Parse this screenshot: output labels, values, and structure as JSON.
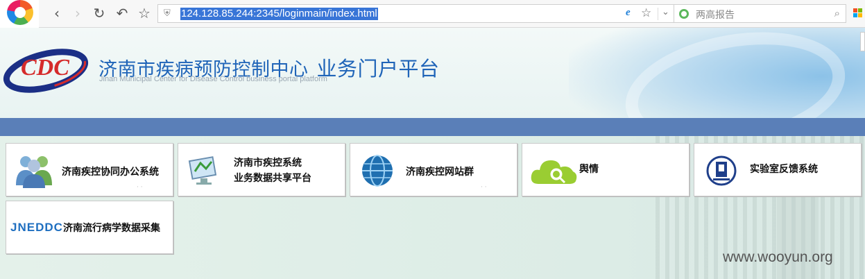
{
  "browser": {
    "url": "124.128.85.244:2345/loginmain/index.html",
    "search_placeholder": "两高报告",
    "back": "‹",
    "forward": "›",
    "reload": "↻",
    "undo": "↶",
    "star": "☆",
    "shield": "⛨",
    "ie": "e",
    "dropdown": "⌄",
    "search_icon": "⌕",
    "grid_colors": [
      "#f25022",
      "#7fba00",
      "#00a4ef",
      "#ffb900"
    ]
  },
  "header": {
    "logo_text": "CDC",
    "title": "济南市疾病预防控制中心",
    "subtitle": "业务门户平台",
    "title_en": "Jinan Municipal Center for Disease Control business portal platform"
  },
  "tiles": [
    {
      "name": "oa",
      "label": "济南疾控协同办公系统"
    },
    {
      "name": "data-share",
      "label_line1": "济南市疾控系统",
      "label_line2": "业务数据共享平台"
    },
    {
      "name": "websites",
      "label": "济南疾控网站群"
    },
    {
      "name": "public-opinion",
      "label": "舆情"
    },
    {
      "name": "lab-feedback",
      "label": "实验室反馈系统"
    },
    {
      "name": "epidemiology",
      "logo_text": "JNEDDC",
      "label": "济南流行病学数据采集"
    }
  ],
  "watermark": "www.wooyun.org"
}
